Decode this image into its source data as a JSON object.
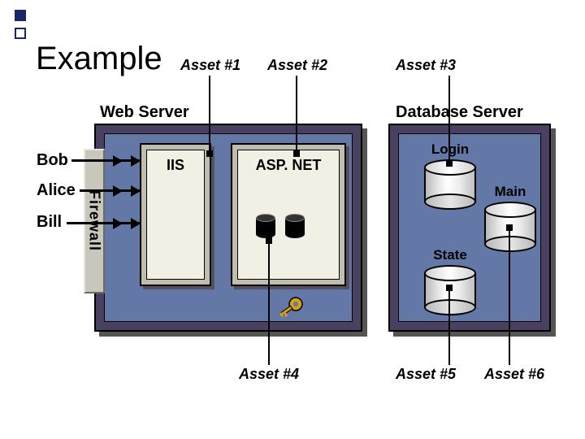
{
  "title": "Example",
  "assets": {
    "a1": "Asset #1",
    "a2": "Asset #2",
    "a3": "Asset #3",
    "a4": "Asset #4",
    "a5": "Asset #5",
    "a6": "Asset #6"
  },
  "servers": {
    "web": "Web Server",
    "db": "Database Server"
  },
  "users": {
    "bob": "Bob",
    "alice": "Alice",
    "bill": "Bill"
  },
  "firewall": "Firewall",
  "components": {
    "iis": "IIS",
    "aspnet": "ASP. NET"
  },
  "databases": {
    "login": "Login",
    "main": "Main",
    "state": "State"
  }
}
